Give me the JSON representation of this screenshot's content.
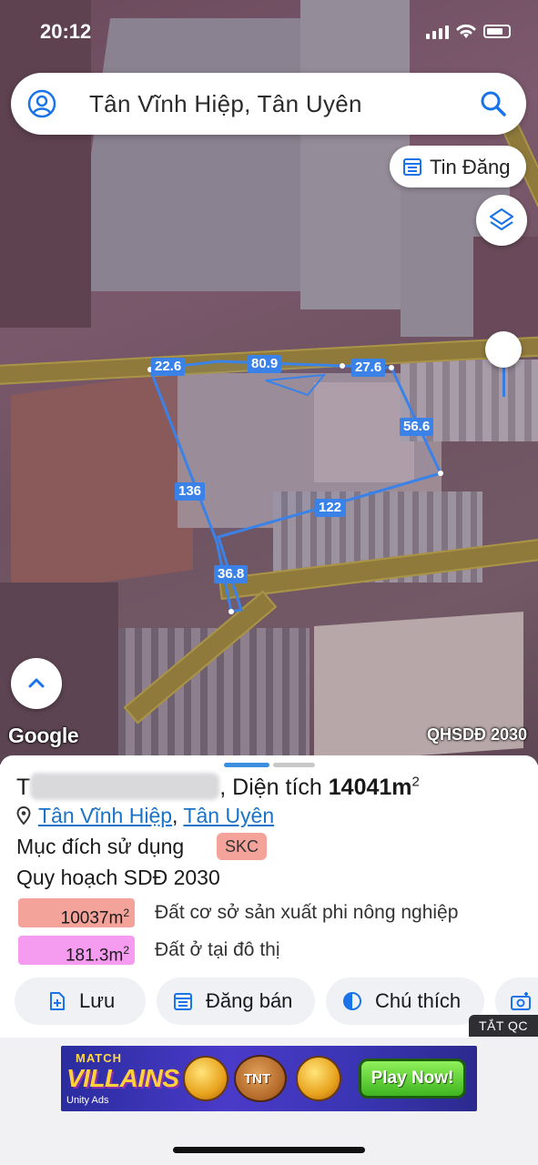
{
  "status_bar": {
    "time": "20:12"
  },
  "search": {
    "query": "Tân Vĩnh Hiệp, Tân Uyên"
  },
  "map": {
    "listing_chip": "Tin Đăng",
    "dimensions": [
      "22.6",
      "80.9",
      "27.6",
      "56.6",
      "136",
      "122",
      "36.8"
    ],
    "attribution": "Google",
    "plan_layer": "QHSDĐ 2030",
    "icons": [
      "user-icon",
      "search-icon",
      "calendar-list-icon",
      "layers-icon",
      "chevron-up-icon"
    ]
  },
  "sheet": {
    "title_prefix": "T",
    "title_area_label": ", Diện tích ",
    "title_area_value": "14041m",
    "title_area_unit_sup": "2",
    "location": {
      "ward": "Tân Vĩnh Hiệp",
      "separator": ",",
      "city": "Tân Uyên"
    },
    "purpose_label": "Mục đích sử dụng",
    "purpose_code": "SKC",
    "plan_label": "Quy hoạch SDĐ 2030",
    "zones": [
      {
        "area": "10037m",
        "sup": "2",
        "description": "Đất cơ sở sản xuất phi nông nghiệp",
        "color": "#f4a39a"
      },
      {
        "area": "181.3m",
        "sup": "2",
        "description": "Đất ở tại đô thị",
        "color": "#f59cf0"
      }
    ],
    "actions": [
      "Lưu",
      "Đăng bán",
      "Chú thích"
    ]
  },
  "ad": {
    "hide_label": "TẮT QC",
    "brand_top": "MATCH",
    "brand_main": "VILLAINS",
    "network": "Unity Ads",
    "tnt_label": "TNT",
    "cta": "Play Now!"
  }
}
